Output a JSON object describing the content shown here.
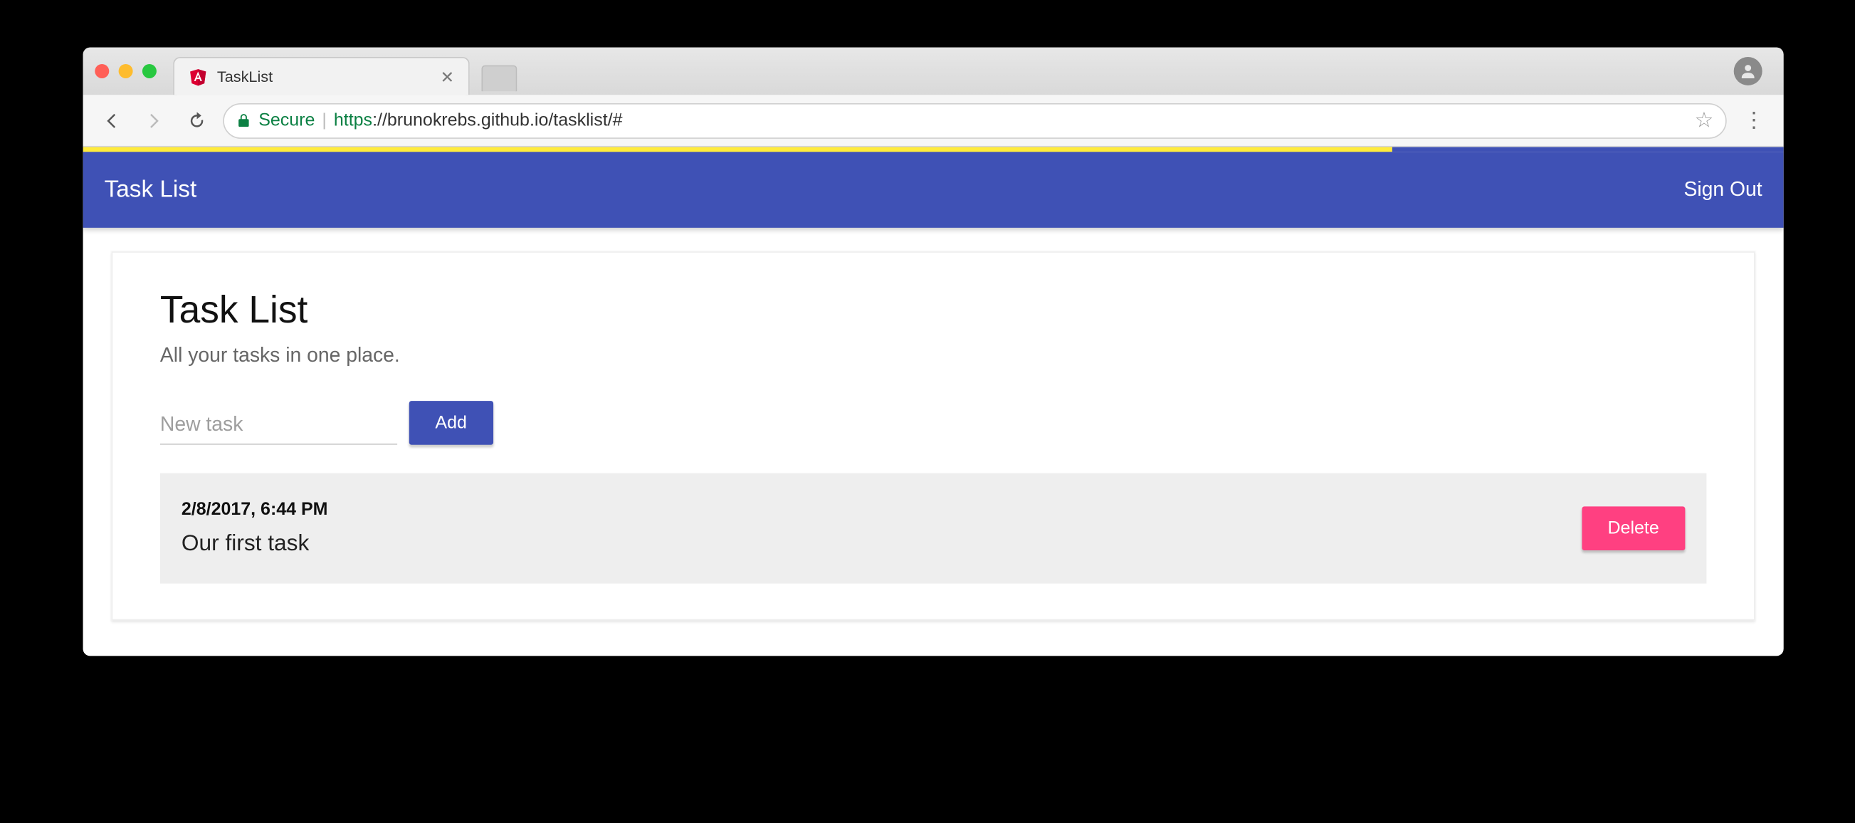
{
  "browser": {
    "tab_title": "TaskList",
    "secure_label": "Secure",
    "url_scheme": "https",
    "url_rest": "://brunokrebs.github.io/tasklist/#"
  },
  "progress": {
    "percent": 77
  },
  "appbar": {
    "title": "Task List",
    "signout_label": "Sign Out"
  },
  "main": {
    "heading": "Task List",
    "subheading": "All your tasks in one place.",
    "new_task_placeholder": "New task",
    "add_button_label": "Add"
  },
  "tasks": [
    {
      "timestamp": "2/8/2017, 6:44 PM",
      "description": "Our first task",
      "delete_label": "Delete"
    }
  ]
}
